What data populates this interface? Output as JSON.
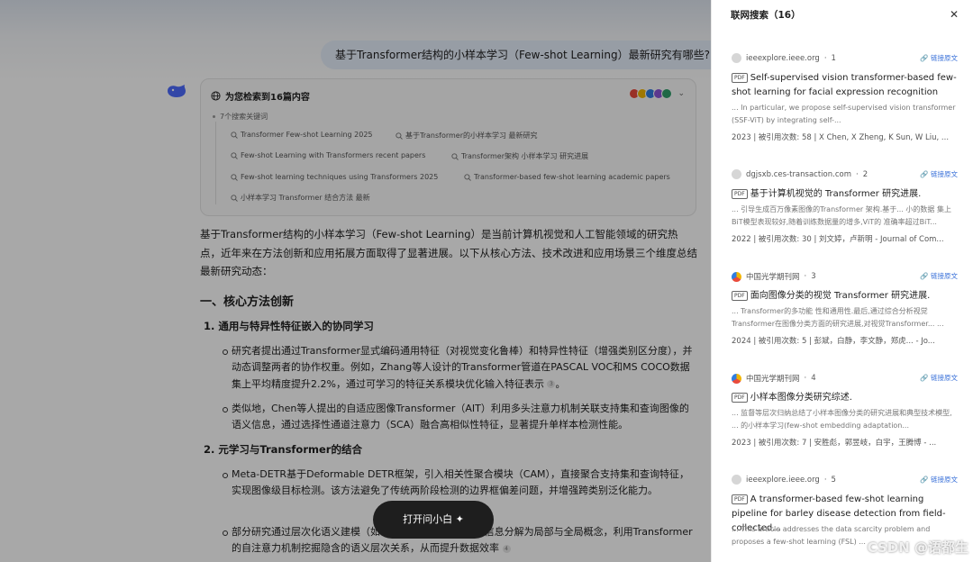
{
  "chat": {
    "user_message": "基于Transformer结构的小样本学习（Few-shot Learning）最新研究有哪些?",
    "search_card": {
      "heading": "为您检索到16篇内容",
      "keywords_title": "7个搜索关键词",
      "keywords": [
        "Transformer Few-shot Learning 2025",
        "基于Transformer的小样本学习 最新研究",
        "Few-shot Learning with Transformers recent papers",
        "Transformer架构 小样本学习 研究进展",
        "Few-shot learning techniques using Transformers 2025",
        "Transformer-based few-shot learning academic papers",
        "小样本学习 Transformer 结合方法 最新"
      ]
    },
    "intro": "基于Transformer结构的小样本学习（Few-shot Learning）是当前计算机视觉和人工智能领域的研究热点，近年来在方法创新和应用拓展方面取得了显著进展。以下从核心方法、技术改进和应用场景三个维度总结最新研究动态：",
    "section1_title": "一、核心方法创新",
    "sub1_title": "1. 通用与特异性特征嵌入的协同学习",
    "bullet1": "研究者提出通过Transformer显式编码通用特征（对视觉变化鲁棒）和特异性特征（增强类别区分度），并动态调整两者的协作权重。例如，Zhang等人设计的Transformer管道在PASCAL VOC和MS COCO数据集上平均精度提升2.2%，通过可学习的特征关系模块优化输入特征表示",
    "bullet2": "类似地，Chen等人提出的自适应图像Transformer（AIT）利用多头注意力机制关联支持集和查询图像的语义信息，通过选择性通道注意力（SCA）融合高相似性特征，显著提升单样本检测性能。",
    "sub2_title": "2. 元学习与Transformer的结合",
    "bullet3": "Meta-DETR基于Deformable DETR框架，引入相关性聚合模块（CAM），直接聚合支持集和查询特征，实现图像级目标检测。该方法避免了传统两阶段检测的边界框偏差问题，并增强跨类别泛化能力。",
    "bullet4": "部分研究通过层次化语义建模（如CLIP-ViT-B/16）将视觉信息分解为局部与全局概念，利用Transformer的自注意力机制挖掘隐含的语义层次关系，从而提升数据效率",
    "fab_label": "打开问小白 ✦",
    "cite_marks": [
      "3",
      "4"
    ]
  },
  "panel": {
    "title": "联网搜索（16）",
    "link_label": "链接原文",
    "pdf_label": "PDF",
    "results": [
      {
        "source": "ieeexplore.ieee.org",
        "index": "1",
        "title": "Self-supervised vision transformer-based few-shot learning for facial expression recognition",
        "snippet": "... In particular, we propose self-supervised vision transformer (SSF-ViT) by integrating self-...",
        "meta": "2023 | 被引用次数: 58 | X Chen, X Zheng, K Sun, W Liu, ..."
      },
      {
        "source": "dgjsxb.ces-transaction.com",
        "index": "2",
        "title": "基于计算机视觉的 Transformer 研究进展.",
        "snippet": "... 引导生成百万像素图像的Transformer 架构.基于... 小的数据 集上BiT模型表现较好,随着训练数据量的增多,ViT的 准确率超过BiT...",
        "meta": "2022 | 被引用次数: 30 | 刘文婷，卢新明 - Journal of Com..."
      },
      {
        "source": "中国光学期刊网",
        "index": "3",
        "title": "面向图像分类的视觉 Transformer 研究进展.",
        "snippet": "... Transformer的多功能 性和通用性.最后,通过综合分析视觉 Transformer在图像分类方面的研究进展,对视觉Transformer... ...",
        "meta": "2024 | 被引用次数: 5 | 彭斌，白静，李文静，郑虎... - Jo..."
      },
      {
        "source": "中国光学期刊网",
        "index": "4",
        "title": "小样本图像分类研究综述.",
        "snippet": "... 监督等层次归纳总结了小样本图像分类的研究进展和典型技术模型, ... 的小样本学习(few-shot embedding adaptation...",
        "meta": "2023 | 被引用次数: 7 | 安胜彪，郭昱岐，白宇，王腾博 - ..."
      },
      {
        "source": "ieeexplore.ieee.org",
        "index": "5",
        "title": "A transformer-based few-shot learning pipeline for barley disease detection from field-collected...",
        "snippet": "... This article addresses the data scarcity problem and proposes a few-shot learning (FSL) ...",
        "meta": ""
      }
    ],
    "watermark": "CSDN @语都生"
  },
  "colors": {
    "accent": "#3b72d9",
    "fab_bg": "#1e1e1e",
    "bubble_bg": "#e6eefb"
  }
}
